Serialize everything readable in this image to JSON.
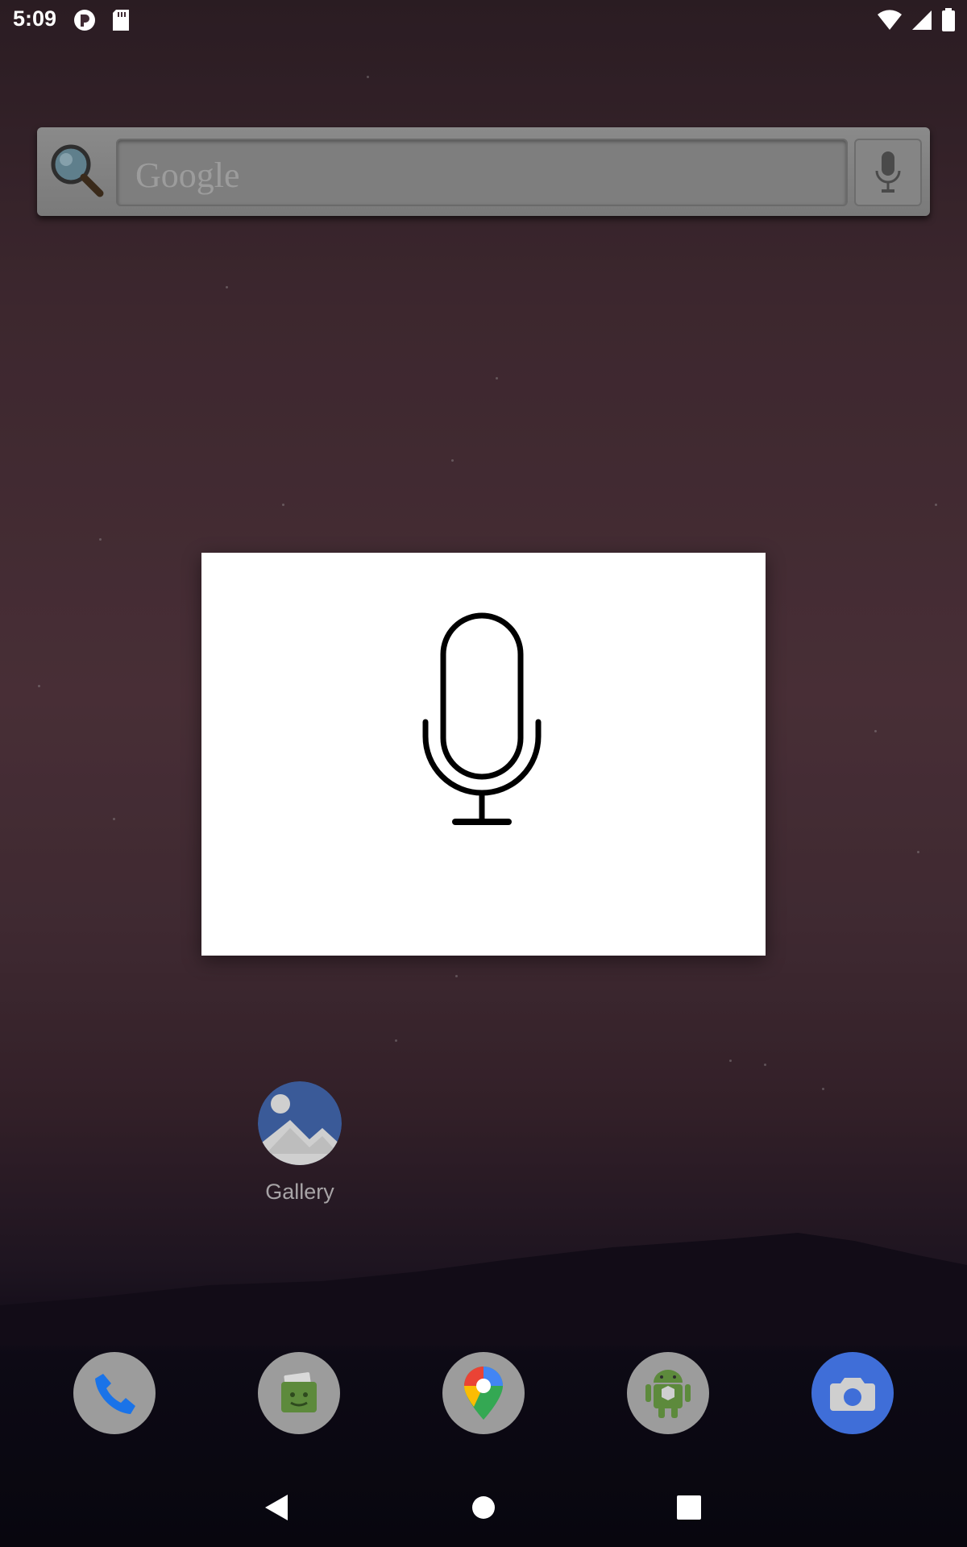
{
  "status_bar": {
    "time": "5:09",
    "left_icons": [
      "tinfoil-icon",
      "sd-card-icon"
    ],
    "right_icons": [
      "wifi-icon",
      "cell-signal-icon",
      "battery-icon"
    ]
  },
  "search_widget": {
    "placeholder": "Google",
    "icons": [
      "magnifier-icon",
      "microphone-icon"
    ]
  },
  "voice_dialog": {
    "icon": "microphone-icon"
  },
  "home": {
    "gallery_label": "Gallery"
  },
  "dock": {
    "items": [
      "phone-icon",
      "messaging-icon",
      "maps-icon",
      "android-app-icon",
      "camera-icon"
    ]
  },
  "nav_bar": {
    "buttons": [
      "back-icon",
      "home-icon",
      "recents-icon"
    ]
  },
  "colors": {
    "dialog_bg": "#ffffff",
    "camera_blue": "#3f6ed8",
    "phone_blue": "#1a73e8"
  }
}
